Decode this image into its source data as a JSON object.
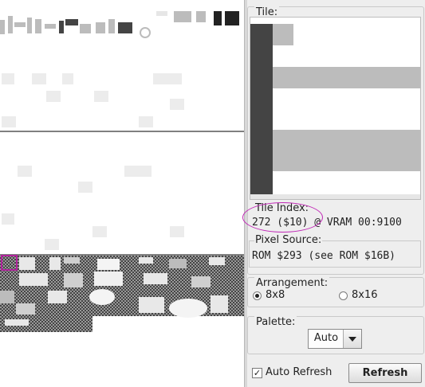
{
  "panel": {
    "tile_title": "Tile:",
    "tile_index_label": "Tile Index:",
    "tile_index_value": "272 ($10) @ VRAM 00:9100",
    "pixel_source_label": "Pixel Source:",
    "pixel_source_value": "ROM $293 (see ROM $16B)",
    "arrangement_label": "Arrangement:",
    "arrangement_options": [
      "8x8",
      "8x16"
    ],
    "arrangement_selected": "8x8",
    "palette_label": "Palette:",
    "palette_value": "Auto",
    "auto_refresh_label": "Auto Refresh",
    "auto_refresh_checked": true,
    "refresh_button": "Refresh"
  },
  "colors": {
    "selection": "#b0239b",
    "annotation_ring": "#c026b6",
    "tile_dark": "#444444",
    "tile_mid": "#bcbcbc",
    "tile_light": "#e6e6e6"
  }
}
